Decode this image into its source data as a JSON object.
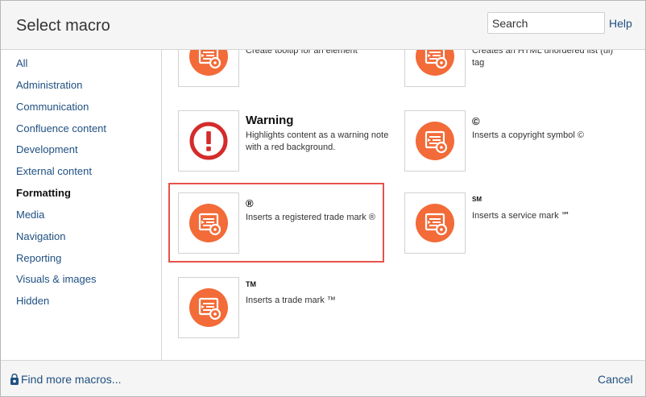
{
  "dialog": {
    "title": "Select macro",
    "search_placeholder": "Search",
    "help_label": "Help"
  },
  "sidebar": {
    "active": "Formatting",
    "items": [
      {
        "label": "All"
      },
      {
        "label": "Administration"
      },
      {
        "label": "Communication"
      },
      {
        "label": "Confluence content"
      },
      {
        "label": "Development"
      },
      {
        "label": "External content"
      },
      {
        "label": "Formatting"
      },
      {
        "label": "Media"
      },
      {
        "label": "Navigation"
      },
      {
        "label": "Reporting"
      },
      {
        "label": "Visuals & images"
      },
      {
        "label": "Hidden"
      }
    ]
  },
  "macros": [
    {
      "name": "",
      "description": "Create tooltip for an element",
      "icon": "macro-gear-icon"
    },
    {
      "name": "",
      "description": "Creates an HTML unordered list (ul) tag",
      "icon": "macro-gear-icon"
    },
    {
      "name": "Warning",
      "description": "Highlights content as a warning note with a red background.",
      "icon": "warning-icon"
    },
    {
      "name": "©",
      "description": "Inserts a copyright symbol ©",
      "icon": "macro-gear-icon"
    },
    {
      "name": "®",
      "description": "Inserts a registered trade mark ®",
      "icon": "macro-gear-icon",
      "selected": true
    },
    {
      "name": "SM",
      "description": "Inserts a service mark ℠",
      "icon": "macro-gear-icon"
    },
    {
      "name": "TM",
      "description": "Inserts a trade mark ™",
      "icon": "macro-gear-icon"
    }
  ],
  "footer": {
    "find_more_label": "Find more macros...",
    "cancel_label": "Cancel"
  },
  "colors": {
    "link": "#205081",
    "macro_icon": "#f26b38",
    "warning": "#d42b2b",
    "selection": "#e5534b"
  }
}
